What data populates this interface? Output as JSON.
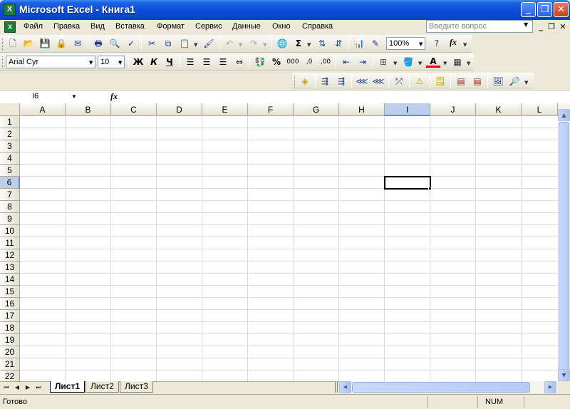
{
  "window": {
    "title": "Microsoft Excel - Книга1",
    "app_icon": "excel-icon",
    "app_icon_glyph": "X",
    "minimize_glyph": "_",
    "maximize_glyph": "❐",
    "close_glyph": "✕"
  },
  "menubar": {
    "doc_icon_glyph": "X",
    "items": [
      "Файл",
      "Правка",
      "Вид",
      "Вставка",
      "Формат",
      "Сервис",
      "Данные",
      "Окно",
      "Справка"
    ],
    "help_placeholder": "Введите вопрос",
    "doc_minimize_glyph": "_",
    "doc_restore_glyph": "❐",
    "doc_close_glyph": "✕"
  },
  "standard_toolbar": {
    "zoom": "100%",
    "sum_glyph": "Σ",
    "fx_glyph": "fx"
  },
  "formatting_toolbar": {
    "font": "Arial Cyr",
    "size": "10",
    "bold_label": "Ж",
    "italic_label": "К",
    "underline_label": "Ч",
    "percent_label": "%",
    "thousands_label": "000",
    "inc_decimal_label": ",0",
    "dec_decimal_label": ",00",
    "font_color_label": "A"
  },
  "formula_bar": {
    "name_box": "I6",
    "fx_label": "fx",
    "content": ""
  },
  "grid": {
    "columns": [
      "A",
      "B",
      "C",
      "D",
      "E",
      "F",
      "G",
      "H",
      "I",
      "J",
      "K",
      "L"
    ],
    "rows": [
      "1",
      "2",
      "3",
      "4",
      "5",
      "6",
      "7",
      "8",
      "9",
      "10",
      "11",
      "12",
      "13",
      "14",
      "15",
      "16",
      "17",
      "18",
      "19",
      "20",
      "21",
      "22"
    ],
    "active_cell": "I6",
    "active_column": "I",
    "active_row": "6"
  },
  "sheets": {
    "tabs": [
      "Лист1",
      "Лист2",
      "Лист3"
    ],
    "active": "Лист1",
    "nav_first": "⏮",
    "nav_prev": "◀",
    "nav_next": "▶",
    "nav_last": "⏭"
  },
  "statusbar": {
    "status": "Готово",
    "num_indicator": "NUM"
  }
}
